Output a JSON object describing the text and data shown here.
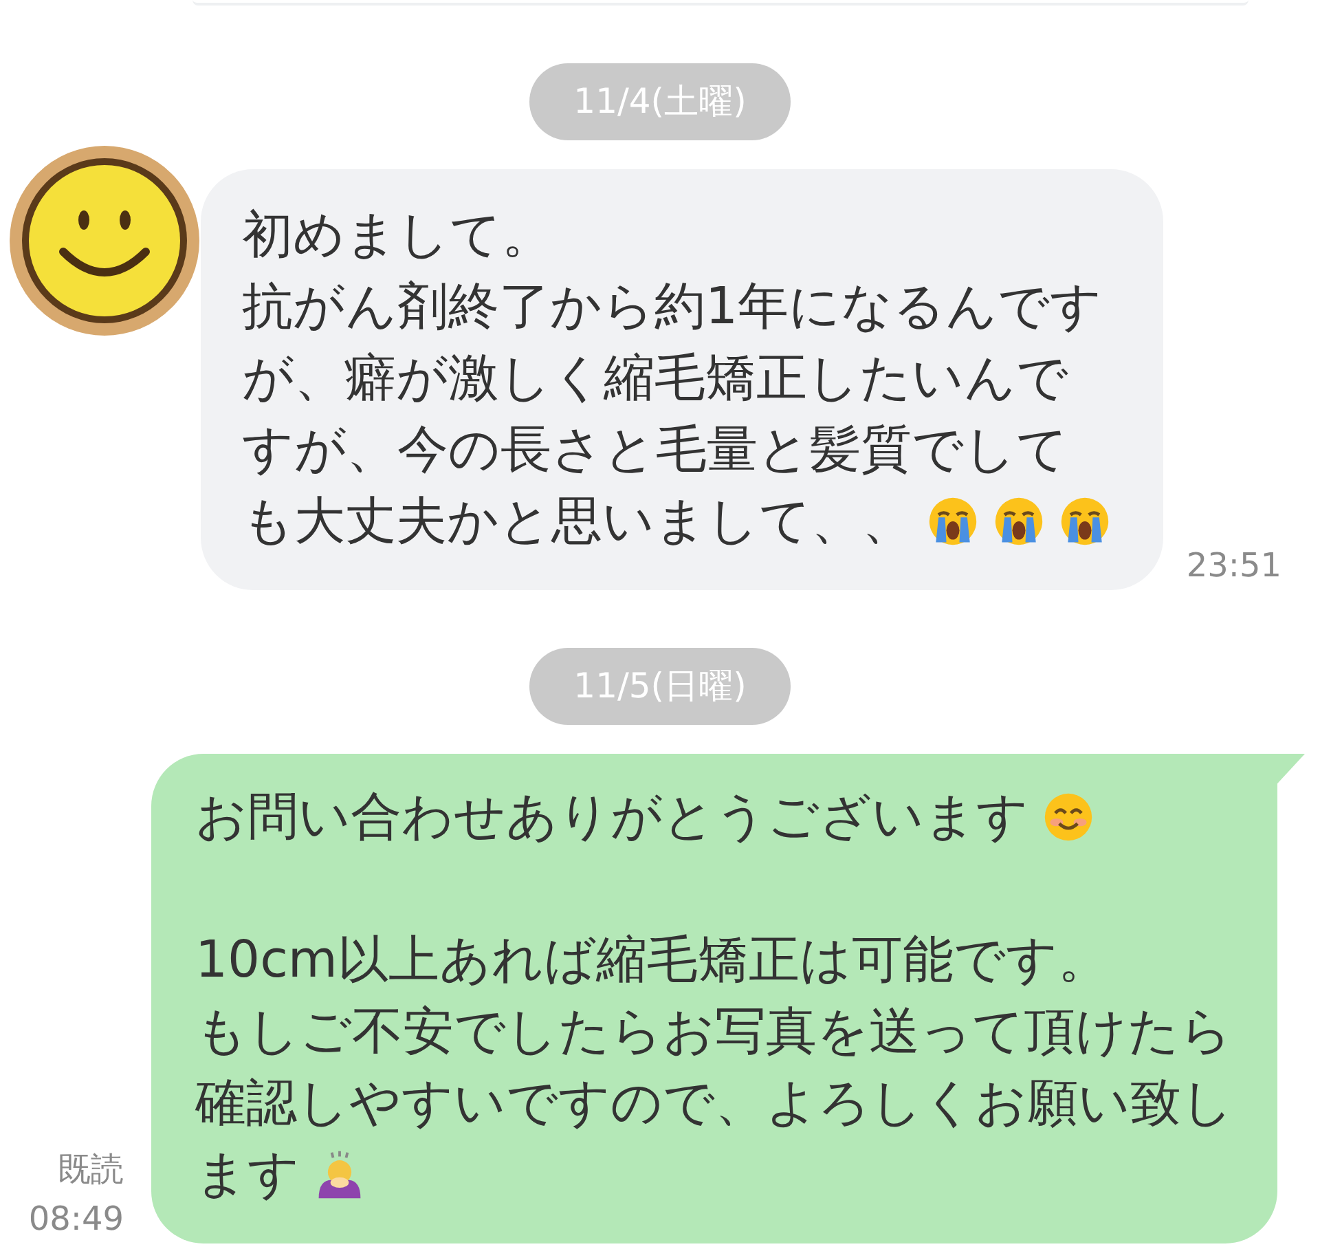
{
  "messages": [
    {
      "kind": "date",
      "label": "11/4(土曜)"
    },
    {
      "kind": "incoming",
      "time": "23:51",
      "paragraphs": [
        [
          {
            "text": "初めまして。"
          },
          {
            "text": "抗がん剤終了から約1年になるんです"
          },
          {
            "text": "が、癖が激しく縮毛矯正したいんで"
          },
          {
            "text": "すが、今の長さと毛量と髪質でして"
          },
          {
            "text": "も大丈夫かと思いまして、、",
            "emojis": [
              {
                "kind": "crying"
              },
              {
                "kind": "crying"
              },
              {
                "kind": "crying"
              }
            ]
          }
        ]
      ]
    },
    {
      "kind": "date",
      "label": "11/5(日曜)"
    },
    {
      "kind": "outgoing",
      "time": "08:49",
      "read": "既読",
      "paragraphs": [
        [
          {
            "text": "お問い合わせありがとうございます",
            "emojis": [
              {
                "kind": "smiling"
              }
            ]
          }
        ],
        [
          {
            "text": "10cm以上あれば縮毛矯正は可能です。"
          },
          {
            "text": "もしご不安でしたらお写真を送って頂けたら"
          },
          {
            "text": "確認しやすいですので、よろしくお願い致し"
          },
          {
            "text": "ます",
            "emojis": [
              {
                "kind": "bowing"
              }
            ]
          }
        ]
      ]
    }
  ]
}
